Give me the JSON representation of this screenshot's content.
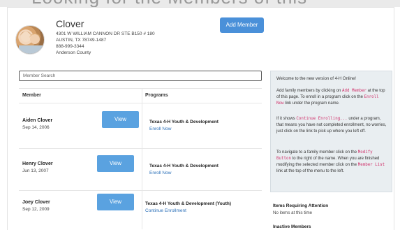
{
  "top_strip_text": "Looking for the Members of this",
  "family": {
    "name": "Clover",
    "address_lines": [
      "4301 W WILLIAM CANNON DR STE B150 # 180",
      "AUSTIN, TX 78749-1487",
      "888-999-3344",
      "Anderson County"
    ]
  },
  "add_member_label": "Add Member",
  "search": {
    "placeholder": "Member Search"
  },
  "table": {
    "headers": {
      "member": "Member",
      "programs": "Programs"
    },
    "view_label": "View",
    "rows": [
      {
        "name": "Aiden Clover",
        "dob": "Sep 14, 2006",
        "program": "Texas 4-H Youth & Development",
        "action": "Enroll Now"
      },
      {
        "name": "Henry Clover",
        "dob": "Jun 13, 2007",
        "program": "Texas 4-H Youth & Development",
        "action": "Enroll Now"
      },
      {
        "name": "Joey Clover",
        "dob": "Sep 12, 2009",
        "program": "Texas 4-H Youth & Development (Youth)",
        "action": "Continue Enrollment"
      }
    ]
  },
  "welcome": {
    "title": "Welcome to the new version of 4-H Online!",
    "p1_a": "Add family members by clicking on",
    "p1_code1": "Add Member",
    "p1_b": "at the top of this page. To enroll in a program click on the",
    "p1_code2": "Enroll Now",
    "p1_c": "link under the program name.",
    "p2_a": "If it shows",
    "p2_code": "Continue Enrolling...",
    "p2_b": "under a program, that means you have not completed enrollment, no worries, just click on the link to pick up where you left off.",
    "p3_a": "To navigate to a family member click on the",
    "p3_code1": "Modify Button",
    "p3_b": "to the right of the name. When you are finished modifying the selected member click on the",
    "p3_code2": "Member List",
    "p3_c": "link at the top of the menu to the left."
  },
  "attention": {
    "title": "Items Requiring Attention",
    "text": "No items at this time"
  },
  "inactive_title": "Inactive Members"
}
